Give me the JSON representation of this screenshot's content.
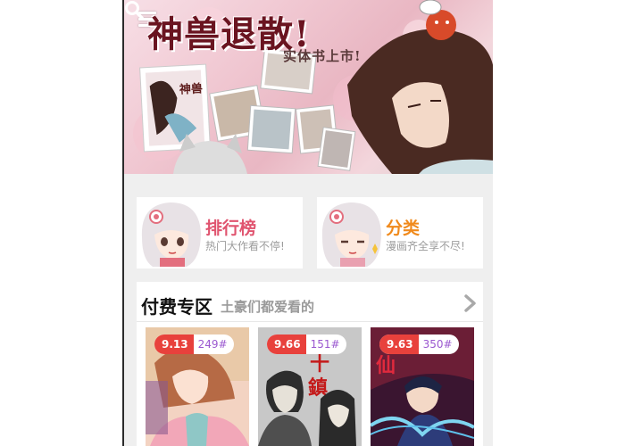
{
  "banner": {
    "title": "神兽退散!",
    "subtitle": "实体书上市!"
  },
  "categories": [
    {
      "title": "排行榜",
      "subtitle": "热门大作看不停!",
      "color": "#e0546f"
    },
    {
      "title": "分类",
      "subtitle": "漫画齐全享不尽!",
      "color": "#f08a1c"
    }
  ],
  "paid": {
    "title": "付费专区",
    "subtitle": "土豪们都爱看的"
  },
  "comics": [
    {
      "score": "9.13",
      "rank": "249#"
    },
    {
      "score": "9.66",
      "rank": "151#"
    },
    {
      "score": "9.63",
      "rank": "350#"
    }
  ],
  "colors": {
    "score_badge": "#e8413c",
    "rank_text": "#9b59d0",
    "page_bg": "#efefef"
  }
}
